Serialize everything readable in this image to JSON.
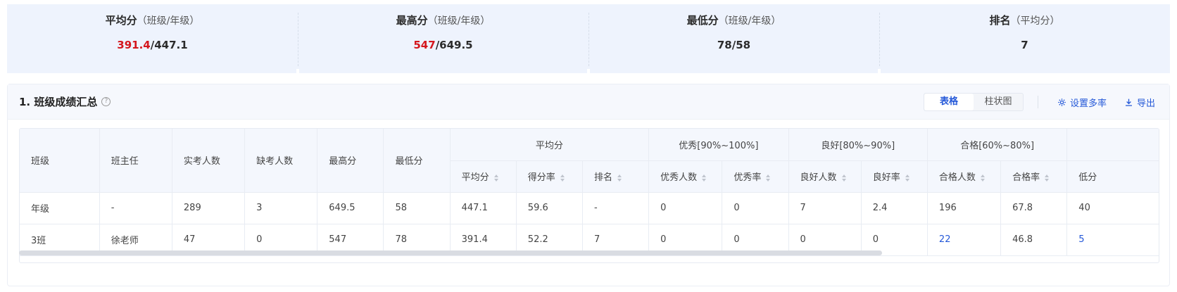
{
  "stats": [
    {
      "title": "平均分",
      "sub": "（班级/年级）",
      "class_value": "391.4",
      "grade_value": "/447.1",
      "highlight": true
    },
    {
      "title": "最高分",
      "sub": "（班级/年级）",
      "class_value": "547",
      "grade_value": "/649.5",
      "highlight": true
    },
    {
      "title": "最低分",
      "sub": "（班级/年级）",
      "class_value": "78/58",
      "grade_value": "",
      "highlight": false
    },
    {
      "title": "排名",
      "sub": "（平均分）",
      "class_value": "7",
      "grade_value": "",
      "highlight": false
    }
  ],
  "section": {
    "title": "1. 班级成绩汇总",
    "help_icon": "question-circle-icon",
    "view_toggle": [
      "表格",
      "柱状图"
    ],
    "active_view": "表格",
    "settings_label": "设置多率",
    "export_label": "导出"
  },
  "table": {
    "fixed_headers": [
      "班级",
      "班主任",
      "实考人数",
      "缺考人数",
      "最高分",
      "最低分"
    ],
    "groups": [
      {
        "label": "平均分",
        "sub": [
          "平均分",
          "得分率",
          "排名"
        ]
      },
      {
        "label": "优秀[90%~100%]",
        "sub": [
          "优秀人数",
          "优秀率"
        ]
      },
      {
        "label": "良好[80%~90%]",
        "sub": [
          "良好人数",
          "良好率"
        ]
      },
      {
        "label": "合格[60%~80%]",
        "sub": [
          "合格人数",
          "合格率"
        ]
      },
      {
        "label": "",
        "sub": [
          "低分"
        ]
      }
    ],
    "rows": [
      [
        "年级",
        "-",
        "289",
        "3",
        "649.5",
        "58",
        "447.1",
        "59.6",
        "-",
        "0",
        "0",
        "7",
        "2.4",
        "196",
        "67.8",
        "40"
      ],
      [
        "3班",
        "徐老师",
        "47",
        "0",
        "547",
        "78",
        "391.4",
        "52.2",
        "7",
        "0",
        "0",
        "0",
        "0",
        "22",
        "46.8",
        "5"
      ]
    ]
  },
  "colors": {
    "accent": "#2458d8",
    "highlight": "#d4171d"
  }
}
